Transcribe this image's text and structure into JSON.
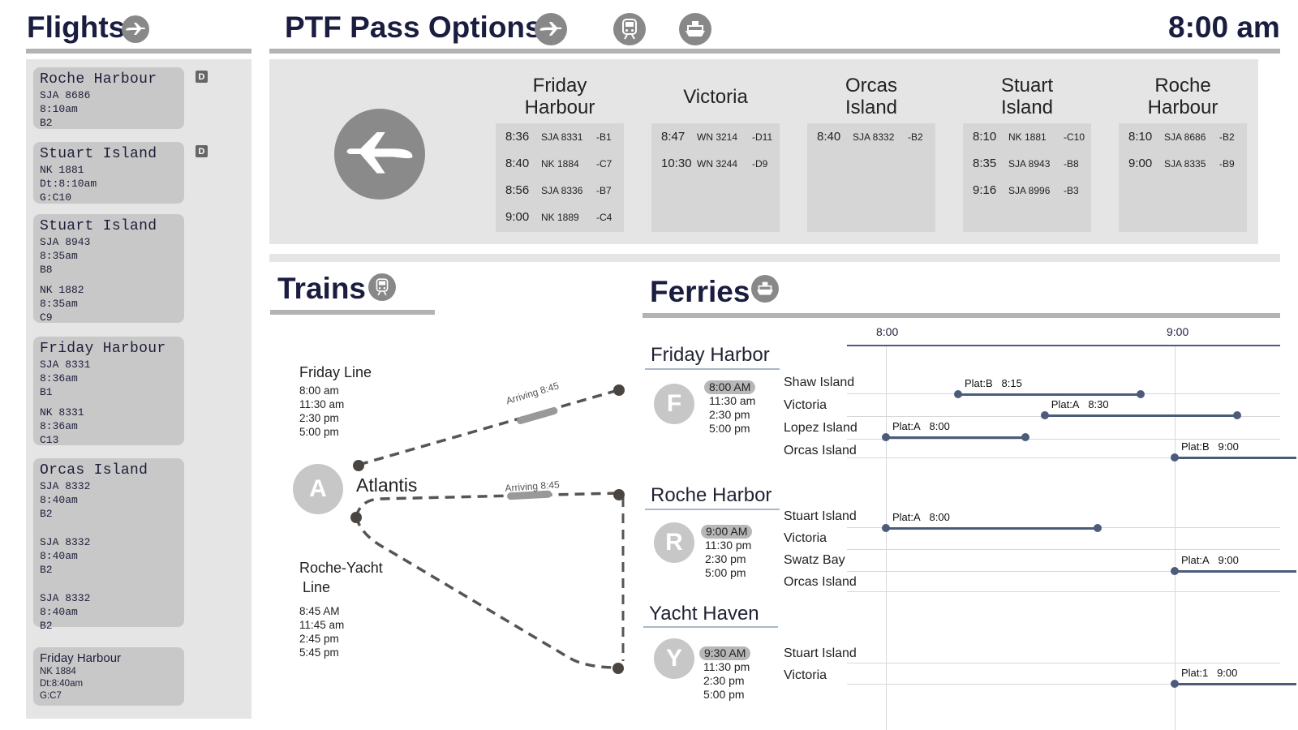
{
  "clock": "8:00 am",
  "flights_panel": {
    "title": "Flights",
    "cards": [
      {
        "dest": "Roche Harbour",
        "lines": [
          "SJA 8686",
          "8:10am",
          "B2"
        ],
        "badge": "D"
      },
      {
        "dest": "Stuart Island",
        "lines": [
          "NK 1881",
          "Dt:8:10am",
          "G:C10"
        ],
        "badge": "D"
      },
      {
        "dest": "Stuart Island",
        "lines": [
          "SJA 8943",
          "8:35am",
          "B8"
        ],
        "lines2": [
          "NK 1882",
          "8:35am",
          "C9"
        ]
      },
      {
        "dest": "Friday Harbour",
        "lines": [
          "SJA 8331",
          "8:36am",
          "B1"
        ],
        "lines2": [
          "NK 8331",
          "8:36am",
          "C13"
        ]
      },
      {
        "dest": "Orcas Island",
        "lines": [
          "SJA 8332",
          "8:40am",
          "B2"
        ],
        "lines2": [
          "SJA 8332",
          "8:40am",
          "B2"
        ],
        "lines3": [
          "SJA 8332",
          "8:40am",
          "B2"
        ]
      },
      {
        "dest": "Friday Harbour",
        "lines": [
          "NK 1884",
          "Dt:8:40am",
          "G:C7"
        ]
      }
    ]
  },
  "pass_options": {
    "title": "PTF Pass Options",
    "destinations": [
      {
        "name": "Friday Harbour",
        "flights": [
          {
            "time": "8:36",
            "flight": "SJA 8331",
            "gate": "-B1"
          },
          {
            "time": "8:40",
            "flight": "NK 1884",
            "gate": "-C7"
          },
          {
            "time": "8:56",
            "flight": "SJA 8336",
            "gate": "-B7"
          },
          {
            "time": "9:00",
            "flight": "NK 1889",
            "gate": "-C4"
          }
        ]
      },
      {
        "name": "Victoria",
        "flights": [
          {
            "time": "8:47",
            "flight": "WN 3214",
            "gate": "-D11"
          },
          {
            "time": "10:30",
            "flight": "WN 3244",
            "gate": "-D9"
          }
        ]
      },
      {
        "name": "Orcas Island",
        "flights": [
          {
            "time": "8:40",
            "flight": "SJA 8332",
            "gate": "-B2"
          }
        ]
      },
      {
        "name": "Stuart Island",
        "flights": [
          {
            "time": "8:10",
            "flight": "NK 1881",
            "gate": "-C10"
          },
          {
            "time": "8:35",
            "flight": "SJA 8943",
            "gate": "-B8"
          },
          {
            "time": "9:16",
            "flight": "SJA 8996",
            "gate": "-B3"
          }
        ]
      },
      {
        "name": "Roche Harbour",
        "flights": [
          {
            "time": "8:10",
            "flight": "SJA 8686",
            "gate": "-B2"
          },
          {
            "time": "9:00",
            "flight": "SJA 8335",
            "gate": "-B9"
          }
        ]
      }
    ]
  },
  "trains": {
    "title": "Trains",
    "station_letter": "A",
    "station_name": "Atlantis",
    "arriving_1": "Arriving 8:45",
    "arriving_2": "Arriving 8:45",
    "friday_line": {
      "name": "Friday Line",
      "times": [
        "8:00 am",
        "11:30 am",
        "2:30 pm",
        "5:00 pm"
      ]
    },
    "roche_line": {
      "name": "Roche-Yacht",
      "name2": "Line",
      "times": [
        "8:45 AM",
        "11:45 am",
        "2:45 pm",
        "5:45 pm"
      ]
    }
  },
  "ferries": {
    "title": "Ferries",
    "axis": {
      "t1": "8:00",
      "t2": "9:00"
    },
    "terminals": [
      {
        "name": "Friday Harbor",
        "letter": "F",
        "times": [
          "8:00 AM",
          "11:30 am",
          "2:30 pm",
          "5:00 pm"
        ],
        "routes": [
          "Shaw Island",
          "Victoria",
          "Lopez Island",
          "Orcas Island"
        ]
      },
      {
        "name": "Roche Harbor",
        "letter": "R",
        "times": [
          "9:00 AM",
          "11:30 pm",
          "2:30 pm",
          "5:00 pm"
        ],
        "routes": [
          "Stuart Island",
          "Victoria",
          "Swatz Bay",
          "Orcas Island"
        ]
      },
      {
        "name": "Yacht Haven",
        "letter": "Y",
        "times": [
          "9:30 AM",
          "11:30 pm",
          "2:30 pm",
          "5:00 pm"
        ],
        "routes": [
          "Stuart Island",
          "Victoria"
        ]
      }
    ],
    "sailings": [
      {
        "plat": "Plat:B",
        "time": "8:15",
        "start": "8:15",
        "end": "8:53"
      },
      {
        "plat": "Plat:A",
        "time": "8:30",
        "start": "8:33",
        "end": "9:13"
      },
      {
        "plat": "Plat:A",
        "time": "8:00",
        "start": "8:00",
        "end": "8:29"
      },
      {
        "plat": "Plat:B",
        "time": "9:00",
        "start": "9:00",
        "end": ""
      },
      {
        "plat": "Plat:A",
        "time": "8:00",
        "start": "8:00",
        "end": "8:44"
      },
      {
        "plat": "Plat:A",
        "time": "9:00",
        "start": "9:00",
        "end": ""
      },
      {
        "plat": "Plat:1",
        "time": "9:00",
        "start": "9:00",
        "end": ""
      }
    ]
  }
}
